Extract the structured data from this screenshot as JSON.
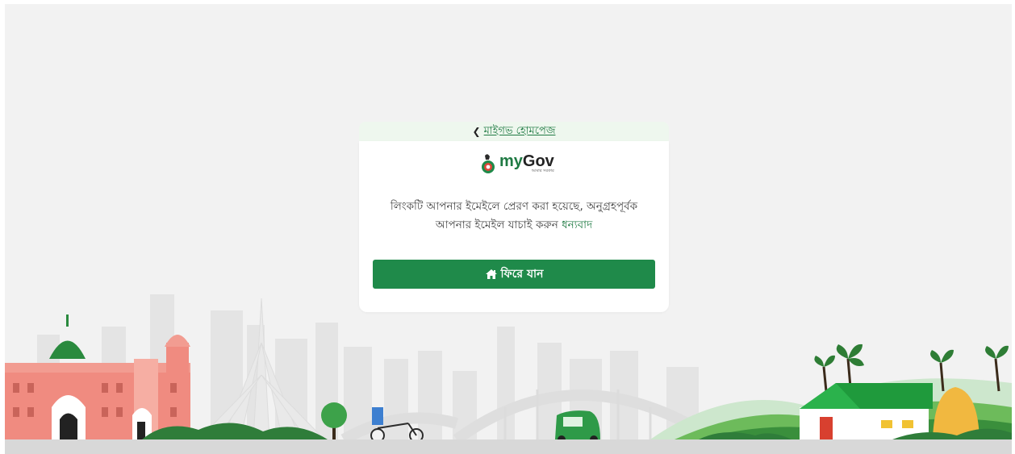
{
  "back_link": {
    "label": "মাইগভ হোমপেজ",
    "icon": "chevron-left-icon"
  },
  "logo": {
    "prefix": "my",
    "suffix": "Gov",
    "tagline": "আমার সরকার"
  },
  "message": {
    "line1": "লিংকটি আপনার ইমেইলে প্রেরণ করা হয়েছে, অনুগ্রহপূর্বক",
    "line2": "আপনার ইমেইল যাচাই করুন",
    "thanks": "ধন্যবাদ"
  },
  "back_button": {
    "label": "ফিরে যান",
    "icon": "home-icon"
  },
  "colors": {
    "accent": "#1f8a4a",
    "link": "#1f7a43",
    "card_top": "#eef7ee",
    "page_bg": "#f2f2f2"
  }
}
